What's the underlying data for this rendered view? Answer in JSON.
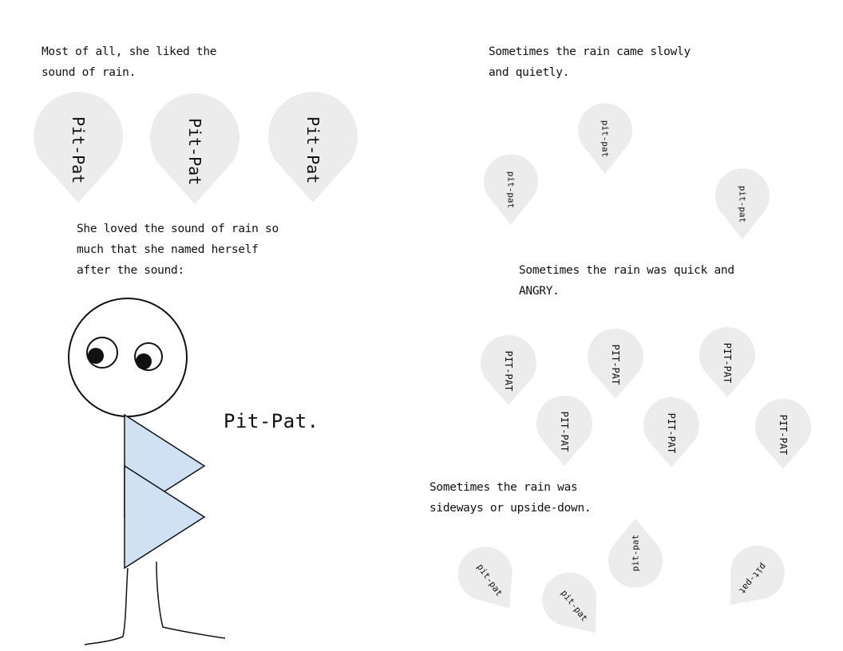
{
  "colors": {
    "drop_fill": "#ececec",
    "body_fill": "#d0e1f3",
    "ink": "#111111"
  },
  "left_page": {
    "text1": "Most of all, she liked the\nsound of rain.",
    "big_drops": [
      "Pit-Pat",
      "Pit-Pat",
      "Pit-Pat"
    ],
    "text2": "She loved the sound of rain so\nmuch that she named herself\nafter the sound:",
    "name": "Pit-Pat."
  },
  "right_page": {
    "slow_text": "Sometimes the rain came slowly\nand quietly.",
    "slow_drops": [
      "pit-pat",
      "pit-pat",
      "pit-pat"
    ],
    "angry_text": "Sometimes the rain was quick and\nANGRY.",
    "angry_drops": [
      "PIT-PAT",
      "PIT-PAT",
      "PIT-PAT",
      "PIT-PAT",
      "PIT-PAT",
      "PIT-PAT"
    ],
    "sideways_text": "Sometimes the rain was\nsideways or upside-down.",
    "sideways_drops": [
      "pit-pat",
      "pit-pat",
      "pit-pat",
      "pit-pat"
    ]
  }
}
